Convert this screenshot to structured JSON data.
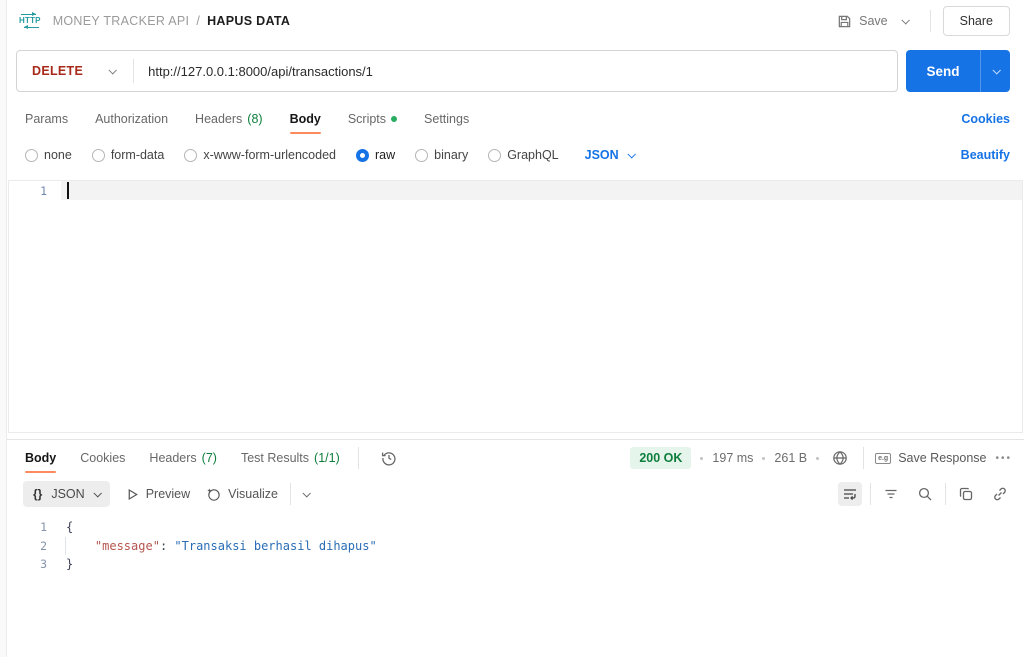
{
  "header": {
    "breadcrumb": {
      "collection": "MONEY TRACKER API",
      "separator": "/",
      "request": "HAPUS DATA"
    },
    "save_label": "Save",
    "share_label": "Share"
  },
  "request_bar": {
    "method": "DELETE",
    "url": "http://127.0.0.1:8000/api/transactions/1",
    "send_label": "Send"
  },
  "request_tabs": {
    "params": "Params",
    "authorization": "Authorization",
    "headers": "Headers",
    "headers_count": "(8)",
    "body": "Body",
    "scripts": "Scripts",
    "settings": "Settings",
    "cookies_link": "Cookies"
  },
  "body_options": {
    "none": "none",
    "form_data": "form-data",
    "urlencoded": "x-www-form-urlencoded",
    "raw": "raw",
    "binary": "binary",
    "graphql": "GraphQL",
    "selected": "raw",
    "language": "JSON",
    "beautify": "Beautify"
  },
  "request_editor": {
    "line1": "1"
  },
  "response": {
    "tabs": {
      "body": "Body",
      "cookies": "Cookies",
      "headers": "Headers",
      "headers_count": "(7)",
      "tests": "Test Results",
      "tests_count": "(1/1)"
    },
    "status": {
      "code": "200 OK",
      "time": "197 ms",
      "size": "261 B"
    },
    "save_response": "Save Response",
    "more": "•••",
    "toolbar": {
      "format_braces": "{}",
      "format": "JSON",
      "preview": "Preview",
      "visualize": "Visualize"
    },
    "code": {
      "line1_num": "1",
      "line1": "{",
      "line2_num": "2",
      "line2_indent": "    ",
      "line2_key": "\"message\"",
      "line2_sep": ": ",
      "line2_val": "\"Transaksi berhasil dihapus\"",
      "line3_num": "3",
      "line3": "}"
    }
  },
  "colors": {
    "accent_blue": "#1673e6",
    "method_delete_red": "#a82a1a",
    "success_green": "#0e7e3c",
    "active_tab_orange": "#ff8a5e",
    "status_badge_bg": "#e6f5ec",
    "json_key": "#b5554d",
    "json_string": "#2a6db5"
  }
}
